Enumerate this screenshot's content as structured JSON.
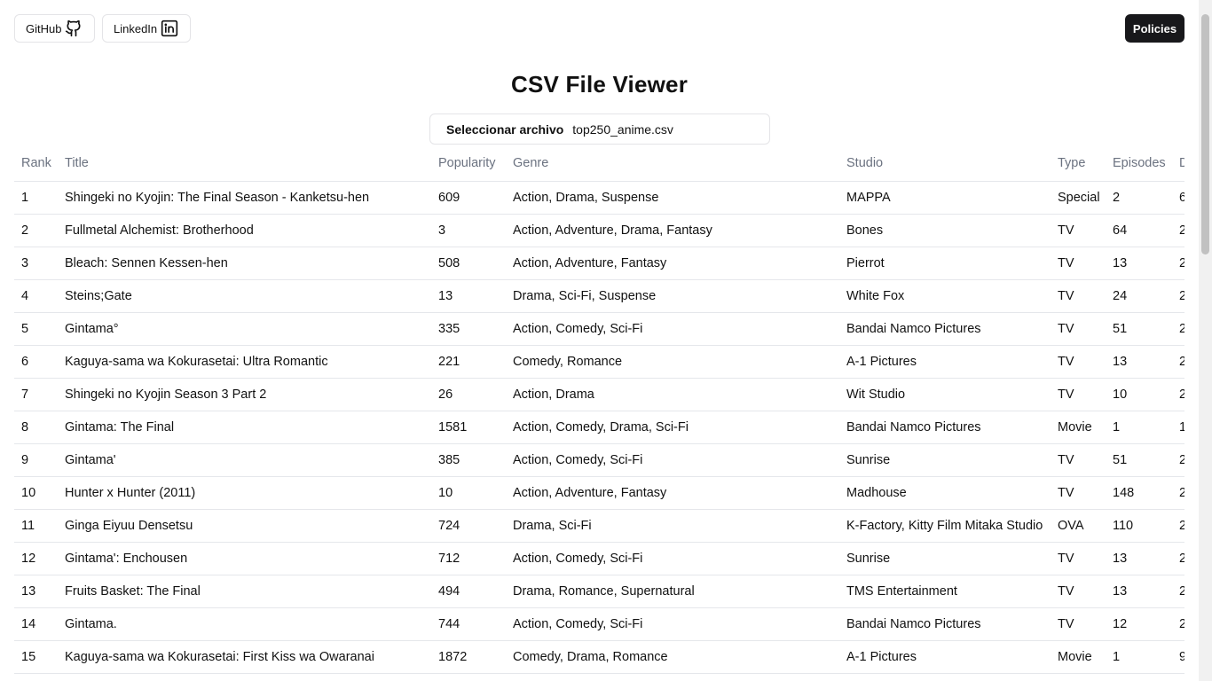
{
  "header": {
    "github_label": "GitHub",
    "linkedin_label": "LinkedIn",
    "policies_label": "Policies"
  },
  "title": "CSV File Viewer",
  "file_input": {
    "button_label": "Seleccionar archivo",
    "file_name": "top250_anime.csv"
  },
  "table": {
    "columns": [
      "Rank",
      "Title",
      "Popularity",
      "Genre",
      "Studio",
      "Type",
      "Episodes",
      "D"
    ],
    "rows": [
      [
        "1",
        "Shingeki no Kyojin: The Final Season - Kanketsu-hen",
        "609",
        "Action, Drama, Suspense",
        "MAPPA",
        "Special",
        "2",
        "6"
      ],
      [
        "2",
        "Fullmetal Alchemist: Brotherhood",
        "3",
        "Action, Adventure, Drama, Fantasy",
        "Bones",
        "TV",
        "64",
        "2"
      ],
      [
        "3",
        "Bleach: Sennen Kessen-hen",
        "508",
        "Action, Adventure, Fantasy",
        "Pierrot",
        "TV",
        "13",
        "2"
      ],
      [
        "4",
        "Steins;Gate",
        "13",
        "Drama, Sci-Fi, Suspense",
        "White Fox",
        "TV",
        "24",
        "2"
      ],
      [
        "5",
        "Gintama°",
        "335",
        "Action, Comedy, Sci-Fi",
        "Bandai Namco Pictures",
        "TV",
        "51",
        "2"
      ],
      [
        "6",
        "Kaguya-sama wa Kokurasetai: Ultra Romantic",
        "221",
        "Comedy, Romance",
        "A-1 Pictures",
        "TV",
        "13",
        "2"
      ],
      [
        "7",
        "Shingeki no Kyojin Season 3 Part 2",
        "26",
        "Action, Drama",
        "Wit Studio",
        "TV",
        "10",
        "2"
      ],
      [
        "8",
        "Gintama: The Final",
        "1581",
        "Action, Comedy, Drama, Sci-Fi",
        "Bandai Namco Pictures",
        "Movie",
        "1",
        "1"
      ],
      [
        "9",
        "Gintama'",
        "385",
        "Action, Comedy, Sci-Fi",
        "Sunrise",
        "TV",
        "51",
        "2"
      ],
      [
        "10",
        "Hunter x Hunter (2011)",
        "10",
        "Action, Adventure, Fantasy",
        "Madhouse",
        "TV",
        "148",
        "2"
      ],
      [
        "11",
        "Ginga Eiyuu Densetsu",
        "724",
        "Drama, Sci-Fi",
        "K-Factory, Kitty Film Mitaka Studio",
        "OVA",
        "110",
        "2"
      ],
      [
        "12",
        "Gintama': Enchousen",
        "712",
        "Action, Comedy, Sci-Fi",
        "Sunrise",
        "TV",
        "13",
        "2"
      ],
      [
        "13",
        "Fruits Basket: The Final",
        "494",
        "Drama, Romance, Supernatural",
        "TMS Entertainment",
        "TV",
        "13",
        "2"
      ],
      [
        "14",
        "Gintama.",
        "744",
        "Action, Comedy, Sci-Fi",
        "Bandai Namco Pictures",
        "TV",
        "12",
        "2"
      ],
      [
        "15",
        "Kaguya-sama wa Kokurasetai: First Kiss wa Owaranai",
        "1872",
        "Comedy, Drama, Romance",
        "A-1 Pictures",
        "Movie",
        "1",
        "9"
      ]
    ]
  }
}
